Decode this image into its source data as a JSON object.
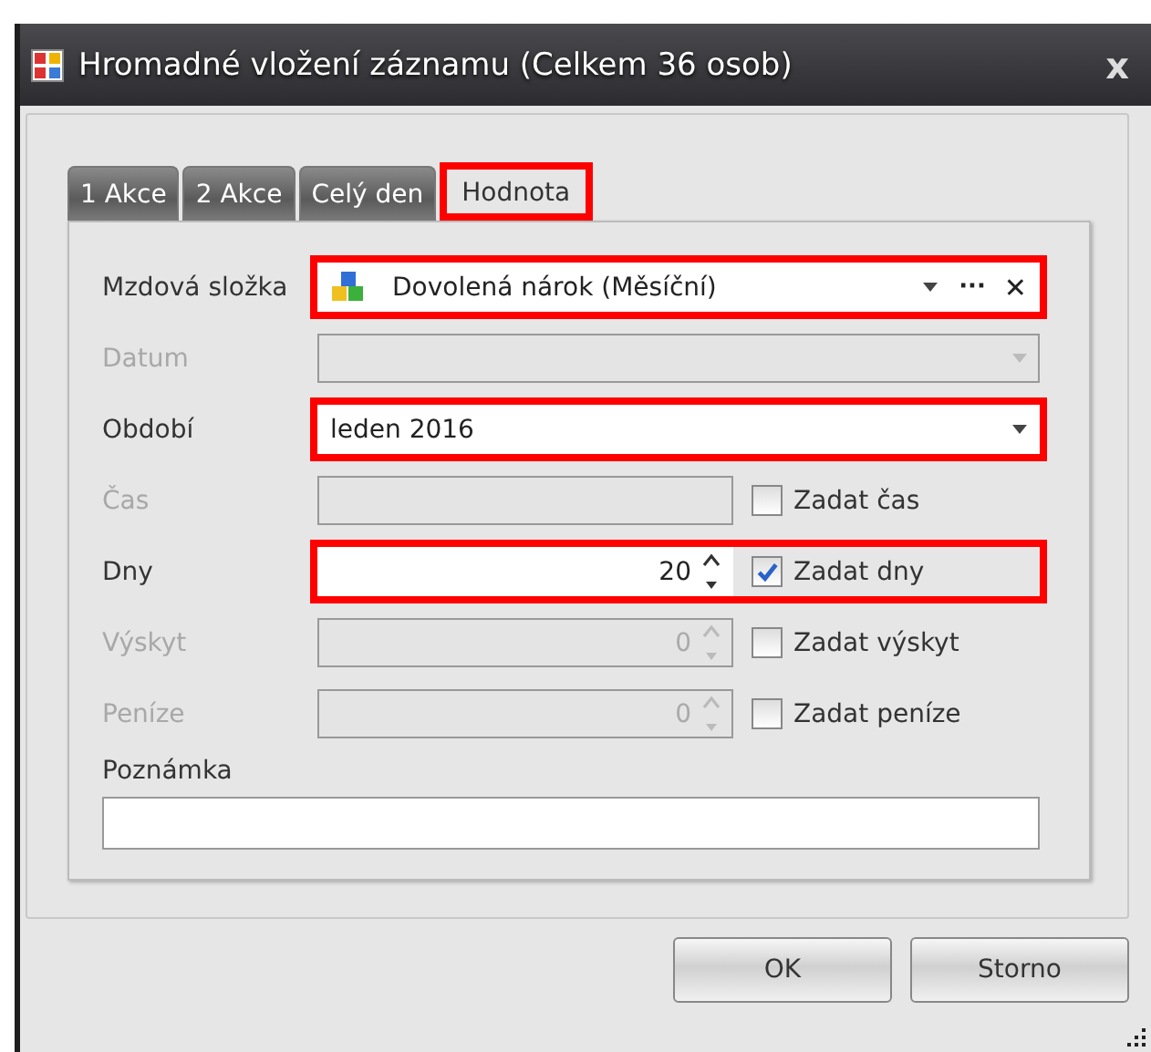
{
  "window": {
    "title": "Hromadné vložení záznamu (Celkem 36 osob)",
    "close": "x"
  },
  "tabs": [
    {
      "label": "1 Akce",
      "selected": false,
      "highlighted": false
    },
    {
      "label": "2 Akce",
      "selected": false,
      "highlighted": false
    },
    {
      "label": "Celý den",
      "selected": false,
      "highlighted": false
    },
    {
      "label": "Hodnota",
      "selected": true,
      "highlighted": true
    }
  ],
  "fields": [
    {
      "kind": "lookup",
      "label": "Mzdová složka",
      "value": "Dovolená nárok (Měsíční)",
      "disabled": false,
      "highlighted": true,
      "more": "···",
      "clear": "✕"
    },
    {
      "kind": "combo",
      "label": "Datum",
      "disabled": true,
      "highlighted": false
    },
    {
      "kind": "combo",
      "label": "Období",
      "value": "leden 2016",
      "disabled": false,
      "highlighted": true
    },
    {
      "kind": "text",
      "label": "Čas",
      "disabled": true,
      "highlighted": false,
      "checkbox": {
        "label": "Zadat čas",
        "checked": false
      }
    },
    {
      "kind": "spin",
      "label": "Dny",
      "value": "20",
      "disabled": false,
      "highlighted": true,
      "checkbox": {
        "label": "Zadat dny",
        "checked": true
      }
    },
    {
      "kind": "spin",
      "label": "Výskyt",
      "value": "0",
      "disabled": true,
      "highlighted": false,
      "checkbox": {
        "label": "Zadat výskyt",
        "checked": false
      }
    },
    {
      "kind": "spin",
      "label": "Peníze",
      "value": "0",
      "disabled": true,
      "highlighted": false,
      "checkbox": {
        "label": "Zadat peníze",
        "checked": false
      }
    }
  ],
  "note": {
    "label": "Poznámka"
  },
  "buttons": [
    "OK",
    "Storno"
  ]
}
